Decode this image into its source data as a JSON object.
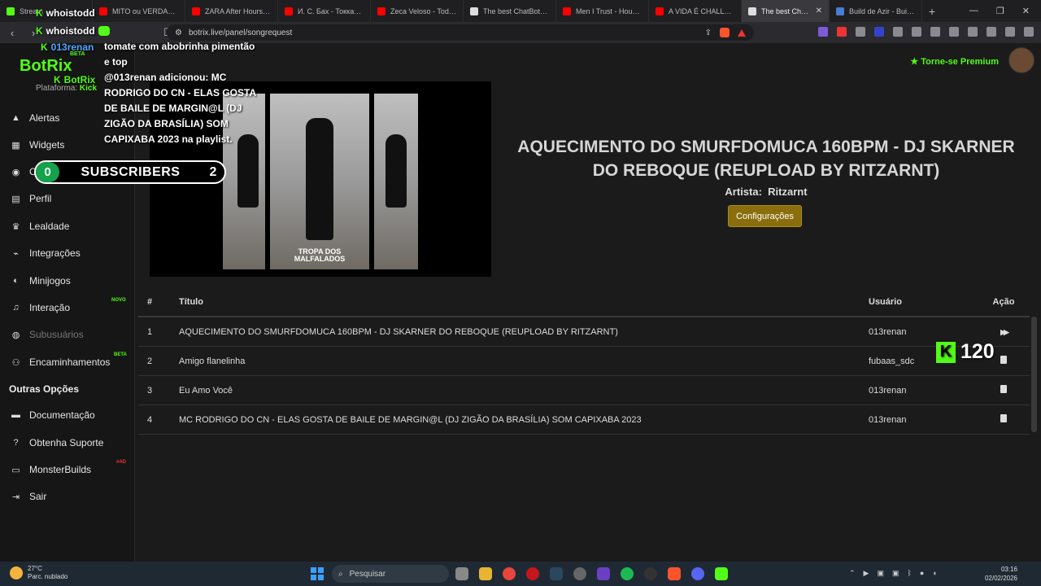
{
  "browser": {
    "tabs": [
      {
        "title": "Stream",
        "color": "#53fc18"
      },
      {
        "title": "MITO ou VERDADE: Tu",
        "color": "#ff0000"
      },
      {
        "title": "ZARA After Hours Dee",
        "color": "#ff0000"
      },
      {
        "title": "И. С. Бах - Токката и ф",
        "color": "#ff0000"
      },
      {
        "title": "Zeca Veloso - Todo Ho",
        "color": "#ff0000"
      },
      {
        "title": "The best ChatBot and",
        "color": "#dddddd"
      },
      {
        "title": "Men I Trust - House Ed",
        "color": "#ff0000"
      },
      {
        "title": "A VIDA É CHALLENGER",
        "color": "#ff0000"
      },
      {
        "title": "The best ChatB",
        "color": "#dddddd",
        "active": true
      },
      {
        "title": "Build de Azir - Builds d",
        "color": "#4a7bd8"
      }
    ],
    "url": "botrix.live/panel/songrequest"
  },
  "sidebar": {
    "logo": "BotRix",
    "logo_badge": "BETA",
    "platform_label": "Plataforma:",
    "platform_value": "Kick",
    "items": [
      {
        "label": "Alertas",
        "icon": "warning-icon"
      },
      {
        "label": "Widgets",
        "icon": "grid-icon"
      },
      {
        "label": "C",
        "icon": "gamepad-icon"
      },
      {
        "label": "Perfil",
        "icon": "id-card-icon"
      },
      {
        "label": "Lealdade",
        "icon": "trophy-icon"
      },
      {
        "label": "Integrações",
        "icon": "plug-icon"
      },
      {
        "label": "Minijogos",
        "icon": "controller-icon"
      },
      {
        "label": "Interação",
        "icon": "music-icon",
        "badge": "NOVO"
      },
      {
        "label": "Subusuários",
        "icon": "users-icon"
      },
      {
        "label": "Encaminhamentos",
        "icon": "share-icon",
        "badge": "BETA"
      }
    ],
    "section_title": "Outras Opções",
    "other_items": [
      {
        "label": "Documentação",
        "icon": "book-icon"
      },
      {
        "label": "Obtenha Suporte",
        "icon": "help-icon"
      },
      {
        "label": "MonsterBuilds",
        "icon": "monitor-icon",
        "badge": "#AD"
      },
      {
        "label": "Sair",
        "icon": "logout-icon"
      }
    ]
  },
  "overlay": {
    "chat_users": [
      "whoistodd",
      "whoistodd",
      "013renan",
      "BotRix"
    ],
    "chat_text_1": "tomate com abobrinha pimentão e top",
    "chat_text_2": "@013renan adicionou: MC RODRIGO DO CN - ELAS GOSTA DE BAILE DE MARGIN@L (DJ ZIGÃO DA BRASÍLIA) SOM CAPIXABA 2023 na playlist.",
    "subs_left": "0",
    "subs_label": "SUBSCRIBERS",
    "subs_right": "2",
    "viewer_count": "120"
  },
  "header": {
    "premium": "Torne-se Premium"
  },
  "player": {
    "watermark_line1": "TROPA DOS",
    "watermark_line2": "MALFALADOS",
    "title": "AQUECIMENTO DO SMURFDOMUCA 160BPM - DJ SKARNER DO REBOQUE (REUPLOAD BY RITZARNT)",
    "artist_label": "Artista:",
    "artist": "Ritzarnt",
    "settings_button": "Configurações"
  },
  "table": {
    "headers": {
      "num": "#",
      "title": "Título",
      "user": "Usuário",
      "action": "Ação"
    },
    "rows": [
      {
        "num": "1",
        "title": "AQUECIMENTO DO SMURFDOMUCA 160BPM - DJ SKARNER DO REBOQUE (REUPLOAD BY RITZARNT)",
        "user": "013renan",
        "action": "fast-forward-icon"
      },
      {
        "num": "2",
        "title": "Amigo flanelinha",
        "user": "fubaas_sdc",
        "action": "trash-icon"
      },
      {
        "num": "3",
        "title": "Eu Amo Você",
        "user": "013renan",
        "action": "trash-icon"
      },
      {
        "num": "4",
        "title": "MC RODRIGO DO CN - ELAS GOSTA DE BAILE DE MARGIN@L (DJ ZIGÃO DA BRASÍLIA) SOM CAPIXABA 2023",
        "user": "013renan",
        "action": "trash-icon"
      }
    ]
  },
  "taskbar": {
    "weather_temp": "27°C",
    "weather_desc": "Parc. nublado",
    "search": "Pesquisar",
    "time": "03:16",
    "date": "02/02/2026"
  }
}
